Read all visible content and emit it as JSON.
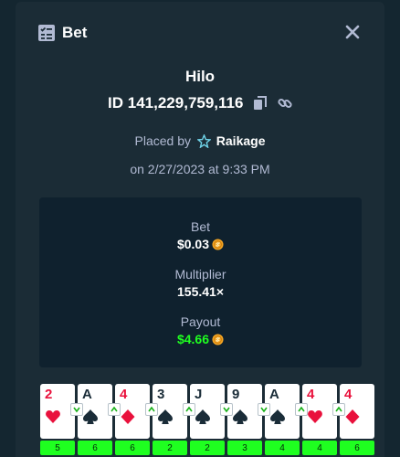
{
  "header": {
    "title": "Bet",
    "icon": "bet-slip-icon",
    "close_icon": "close-icon"
  },
  "bet": {
    "game": "Hilo",
    "id": "ID 141,229,759,116",
    "placed_by_prefix": "Placed by",
    "user": "Raikage",
    "date": "on 2/27/2023 at 9:33 PM"
  },
  "stats": {
    "bet_label": "Bet",
    "bet_value": "$0.03",
    "multiplier_label": "Multiplier",
    "multiplier_value": "155.41×",
    "payout_label": "Payout",
    "payout_value": "$4.66"
  },
  "colors": {
    "payout": "#1fff20",
    "red_suit": "#e9113c",
    "modal": "#1b2c36",
    "panel": "#0f212e"
  },
  "cards": [
    {
      "rank": "2",
      "suit": "hearts",
      "guess": null,
      "mult": "5"
    },
    {
      "rank": "A",
      "suit": "spades",
      "guess": "lower",
      "mult": "6"
    },
    {
      "rank": "4",
      "suit": "diamonds",
      "guess": "higher",
      "mult": "6"
    },
    {
      "rank": "3",
      "suit": "spades",
      "guess": "higher",
      "mult": "2"
    },
    {
      "rank": "J",
      "suit": "spades",
      "guess": "higher",
      "mult": "2"
    },
    {
      "rank": "9",
      "suit": "spades",
      "guess": "lower",
      "mult": "3"
    },
    {
      "rank": "A",
      "suit": "spades",
      "guess": "lower",
      "mult": "4"
    },
    {
      "rank": "4",
      "suit": "hearts",
      "guess": "higher",
      "mult": "4"
    },
    {
      "rank": "4",
      "suit": "diamonds",
      "guess": "higher",
      "mult": "6"
    }
  ]
}
